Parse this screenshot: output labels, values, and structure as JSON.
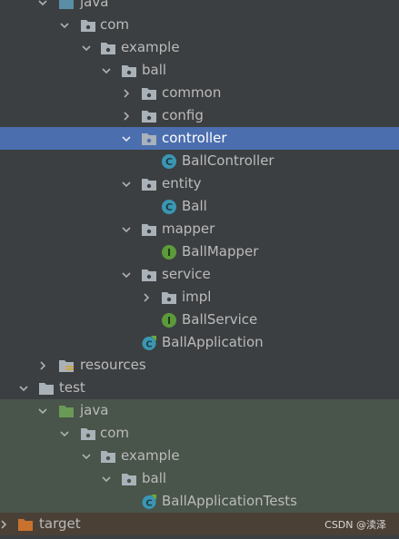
{
  "colors": {
    "background": "#3c3f41",
    "selection": "#4b6eaf",
    "test_background": "#49544a",
    "excluded_background": "#4a4036",
    "folder_gray": "#a9b2b8",
    "folder_blue": "#5a8ea6",
    "folder_green": "#6a9955",
    "folder_orange": "#c9722d",
    "class_icon": "#3a97b3",
    "interface_icon": "#5c9b3b"
  },
  "tree": {
    "rows": [
      {
        "label": "java",
        "icon": "source-folder-icon",
        "expanded": true
      },
      {
        "label": "com",
        "icon": "package-icon",
        "expanded": true
      },
      {
        "label": "example",
        "icon": "package-icon",
        "expanded": true
      },
      {
        "label": "ball",
        "icon": "package-icon",
        "expanded": true
      },
      {
        "label": "common",
        "icon": "package-icon",
        "expanded": false
      },
      {
        "label": "config",
        "icon": "package-icon",
        "expanded": false
      },
      {
        "label": "controller",
        "icon": "package-icon",
        "expanded": true,
        "selected": true
      },
      {
        "label": "BallController",
        "icon": "class-icon"
      },
      {
        "label": "entity",
        "icon": "package-icon",
        "expanded": true
      },
      {
        "label": "Ball",
        "icon": "class-icon"
      },
      {
        "label": "mapper",
        "icon": "package-icon",
        "expanded": true
      },
      {
        "label": "BallMapper",
        "icon": "interface-icon"
      },
      {
        "label": "service",
        "icon": "package-icon",
        "expanded": true
      },
      {
        "label": "impl",
        "icon": "package-icon",
        "expanded": false
      },
      {
        "label": "BallService",
        "icon": "interface-icon"
      },
      {
        "label": "BallApplication",
        "icon": "spring-boot-class-icon"
      },
      {
        "label": "resources",
        "icon": "resources-folder-icon",
        "expanded": false
      },
      {
        "label": "test",
        "icon": "folder-icon",
        "expanded": true
      },
      {
        "label": "java",
        "icon": "test-source-folder-icon",
        "expanded": true
      },
      {
        "label": "com",
        "icon": "package-icon",
        "expanded": true
      },
      {
        "label": "example",
        "icon": "package-icon",
        "expanded": true
      },
      {
        "label": "ball",
        "icon": "package-icon",
        "expanded": true
      },
      {
        "label": "BallApplicationTests",
        "icon": "spring-boot-test-class-icon"
      },
      {
        "label": "target",
        "icon": "excluded-folder-icon",
        "expanded": false
      }
    ]
  },
  "watermark": "CSDN @渎泽"
}
